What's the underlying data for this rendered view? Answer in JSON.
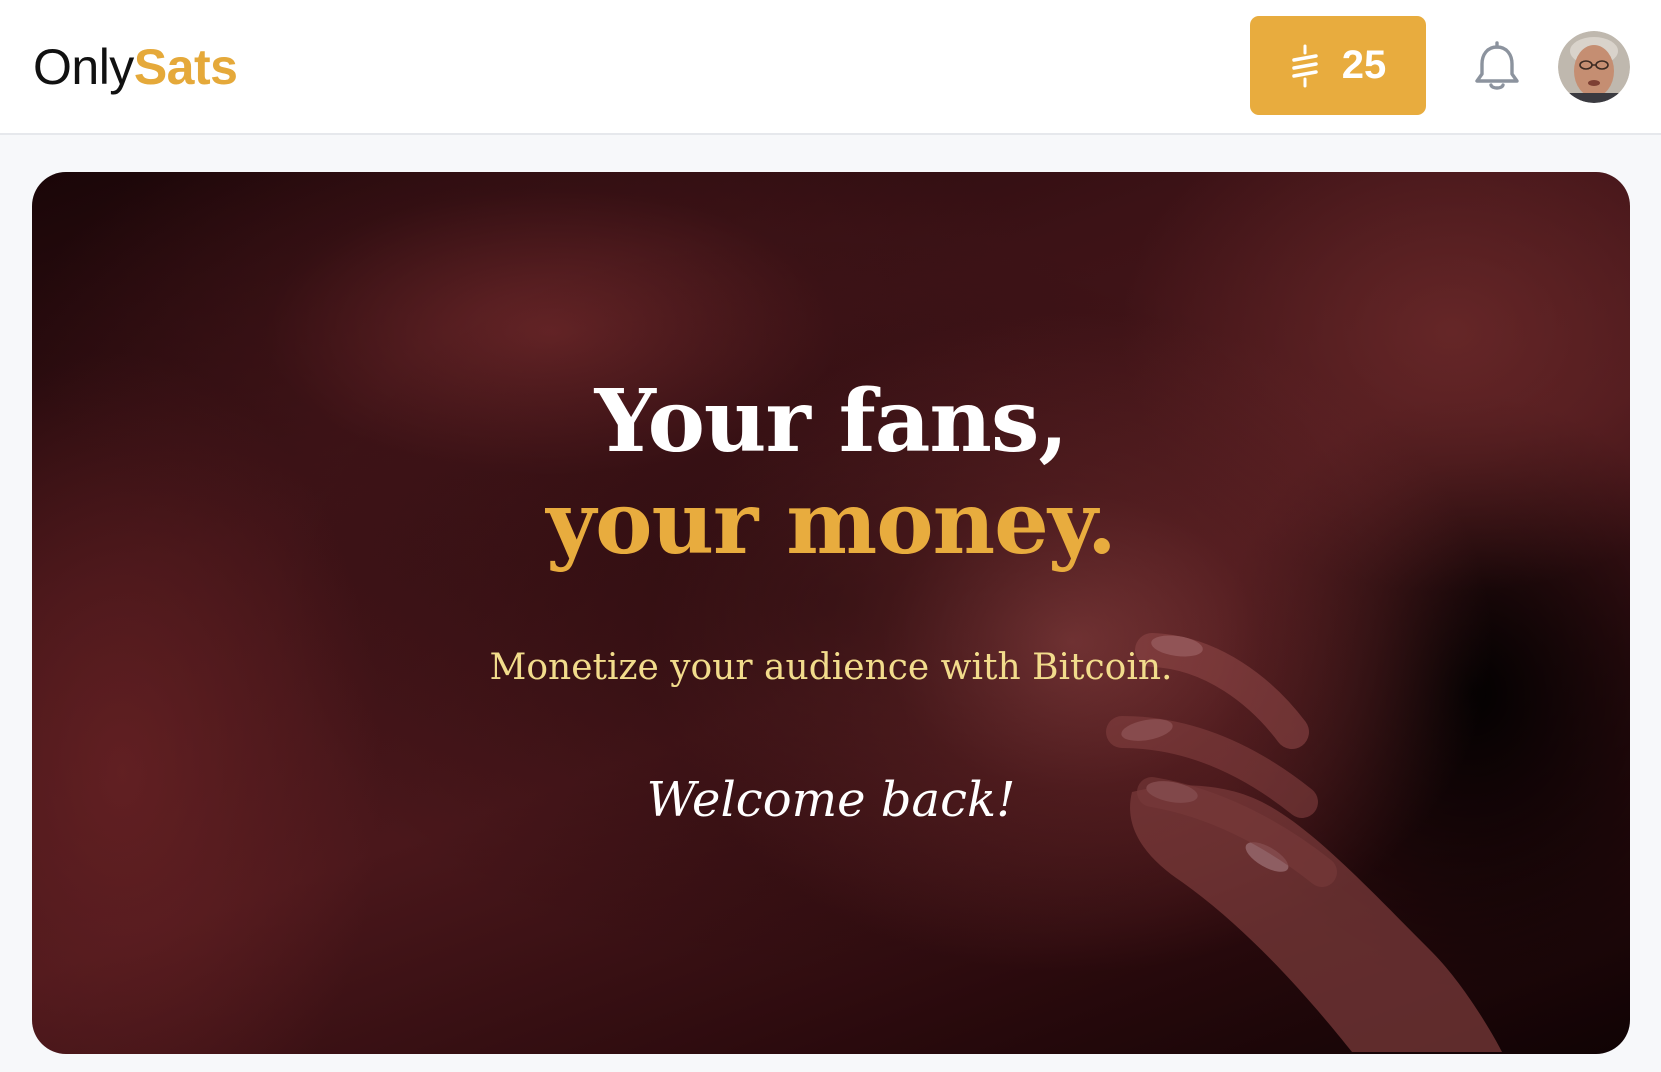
{
  "header": {
    "logo_part1": "Only",
    "logo_part2": "Sats",
    "sats_balance": "25",
    "sats_icon": "satoshi-icon",
    "notifications_icon": "bell-icon",
    "avatar_icon": "user-avatar"
  },
  "hero": {
    "headline_line1": "Your fans,",
    "headline_line2": "your money.",
    "tagline": "Monetize your audience with Bitcoin.",
    "welcome": "Welcome back!"
  },
  "colors": {
    "accent": "#e8ac3e",
    "tagline": "#f2dc8c",
    "header_bg": "#ffffff",
    "page_bg": "#f7f8fa"
  }
}
